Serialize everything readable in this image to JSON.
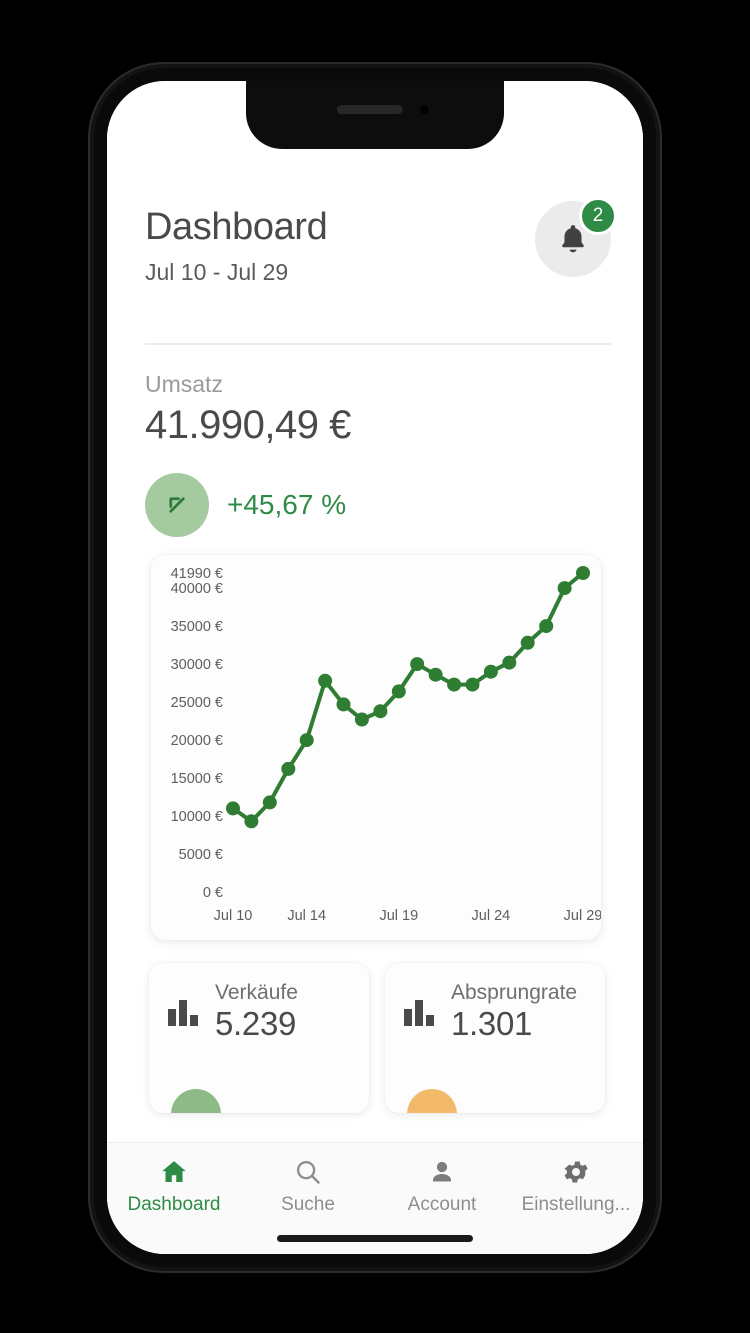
{
  "header": {
    "title": "Dashboard",
    "date_range": "Jul 10 - Jul 29",
    "notification_icon": "bell-icon",
    "notification_count": "2"
  },
  "kpi": {
    "label": "Umsatz",
    "value": "41.990,49 €",
    "delta": "+45,67 %",
    "delta_icon": "arrow-up-left-icon",
    "delta_color": "#2e8b45"
  },
  "chart_data": {
    "type": "line",
    "title": "",
    "xlabel": "",
    "ylabel": "",
    "line_color": "#2f7d33",
    "grid": false,
    "legend": false,
    "ylim": [
      0,
      41990
    ],
    "ytick_labels": [
      "41990 €",
      "40000 €",
      "35000 €",
      "30000 €",
      "25000 €",
      "20000 €",
      "15000 €",
      "10000 €",
      "5000 €",
      "0 €"
    ],
    "ytick_values": [
      41990,
      40000,
      35000,
      30000,
      25000,
      20000,
      15000,
      10000,
      5000,
      0
    ],
    "xtick_labels": [
      "Jul 10",
      "Jul 14",
      "Jul 19",
      "Jul 24",
      "Jul 29"
    ],
    "xtick_indices": [
      0,
      4,
      9,
      14,
      19
    ],
    "x": [
      "Jul 10",
      "Jul 11",
      "Jul 12",
      "Jul 13",
      "Jul 14",
      "Jul 15",
      "Jul 16",
      "Jul 17",
      "Jul 18",
      "Jul 19",
      "Jul 20",
      "Jul 21",
      "Jul 22",
      "Jul 23",
      "Jul 24",
      "Jul 25",
      "Jul 26",
      "Jul 27",
      "Jul 28",
      "Jul 29"
    ],
    "values": [
      11000,
      9300,
      11800,
      16200,
      20000,
      27800,
      24700,
      22700,
      23800,
      26400,
      30000,
      28600,
      27300,
      27300,
      29000,
      30200,
      32800,
      35000,
      40000,
      41990
    ]
  },
  "stats": [
    {
      "icon": "bar-chart-icon",
      "name": "Verkäufe",
      "value": "5.239",
      "dot_color": "green"
    },
    {
      "icon": "bar-chart-icon",
      "name": "Absprungrate",
      "value": "1.301",
      "dot_color": "orange"
    }
  ],
  "nav": [
    {
      "icon": "home-icon",
      "label": "Dashboard",
      "active": true
    },
    {
      "icon": "search-icon",
      "label": "Suche",
      "active": false
    },
    {
      "icon": "person-icon",
      "label": "Account",
      "active": false
    },
    {
      "icon": "gear-icon",
      "label": "Einstellung...",
      "active": false
    }
  ]
}
